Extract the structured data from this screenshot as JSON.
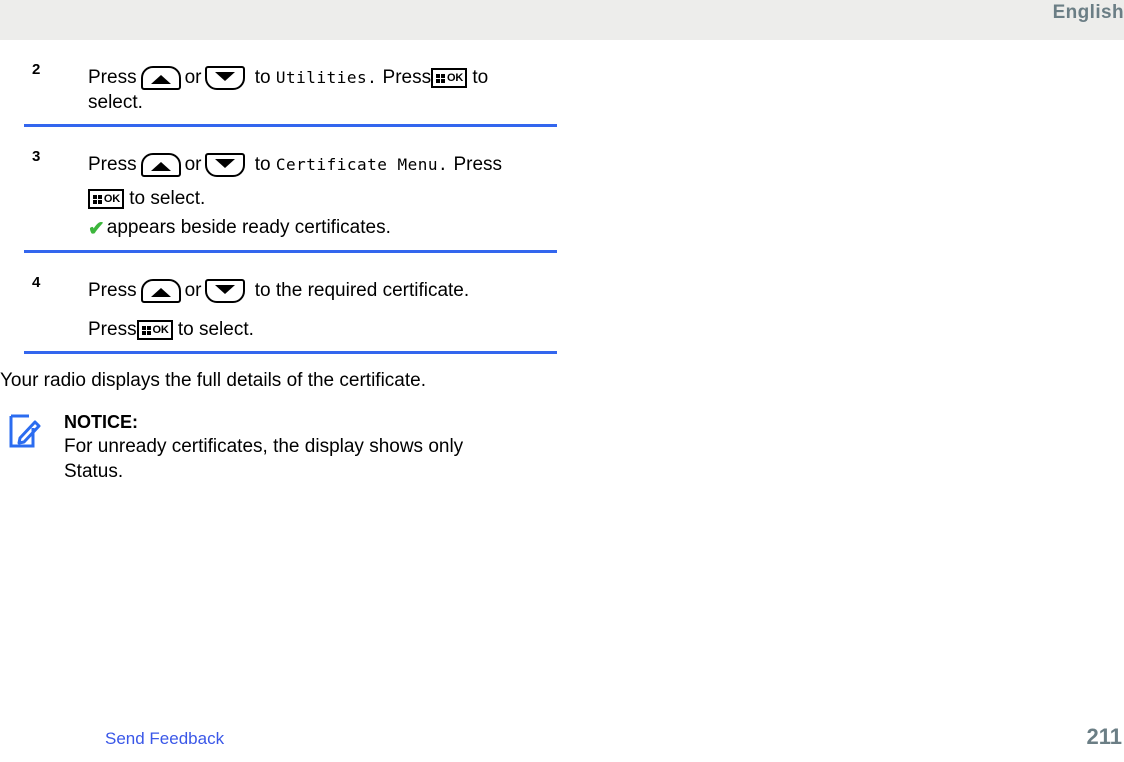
{
  "header": {
    "language": "English"
  },
  "steps": [
    {
      "number": "2",
      "pre": "Press",
      "mid": "or",
      "to": "to",
      "target": "Utilities.",
      "press2": "Press",
      "after_ok": "to",
      "second_line": "select."
    },
    {
      "number": "3",
      "pre": "Press",
      "mid": "or",
      "to": "to",
      "target": "Certificate Menu.",
      "press2": "Press",
      "after_ok": "to select.",
      "note_check": "✔",
      "note_text": "appears beside ready certificates."
    },
    {
      "number": "4",
      "pre": "Press",
      "mid": "or",
      "to": "to the required certificate.",
      "press2": "Press",
      "after_ok": "to select."
    }
  ],
  "body_paragraph": "Your radio displays the full details of the certificate.",
  "notice": {
    "title": "NOTICE:",
    "text": "For unready certificates, the display shows only Status."
  },
  "footer": {
    "feedback_label": "Send Feedback",
    "page_number": "211"
  },
  "colors": {
    "header_band": "#ededeb",
    "header_text": "#6b7e85",
    "rule_blue": "#3366ee",
    "link_blue": "#3a57e8",
    "check_green": "#3cb63c",
    "notice_icon_blue": "#2b6cf0",
    "page_number": "#6b7e85"
  },
  "icons": {
    "up_key": "arrow-up-key",
    "down_key": "arrow-down-key",
    "ok_key": "menu-ok-key",
    "notice": "notice-pencil-icon",
    "check": "green-check-icon"
  }
}
